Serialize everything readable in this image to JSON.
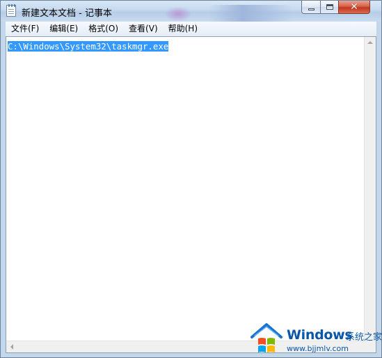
{
  "window": {
    "title": "新建文本文档 - 记事本"
  },
  "menu": {
    "items": [
      {
        "label": "文件(F)"
      },
      {
        "label": "编辑(E)"
      },
      {
        "label": "格式(O)"
      },
      {
        "label": "查看(V)"
      },
      {
        "label": "帮助(H)"
      }
    ]
  },
  "editor": {
    "content": "C:\\Windows\\System32\\taskmgr.exe",
    "selection_color": "#3399ff"
  },
  "watermark": {
    "brand": "Windows",
    "cn": "系统之家",
    "url": "www.bjjmlv.com"
  },
  "icons": {
    "app": "notepad-icon",
    "minimize": "minimize-icon",
    "maximize": "maximize-icon",
    "close": "close-icon",
    "logo": "windows-house-logo-icon"
  }
}
